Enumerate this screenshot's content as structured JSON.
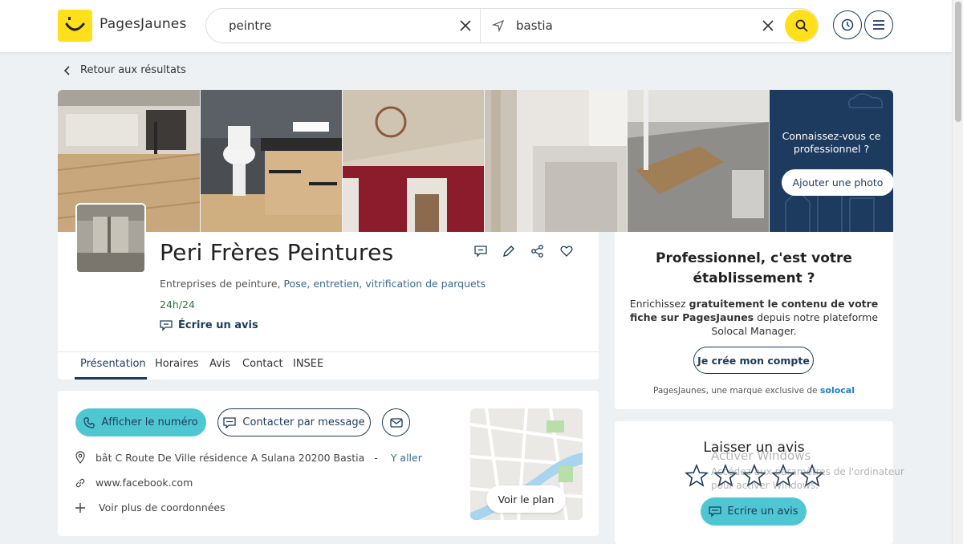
{
  "header": {
    "logo_text": "PagesJaunes",
    "search_what": "peintre",
    "search_where": "bastia"
  },
  "back_link": "Retour aux résultats",
  "gallery": {
    "promo_text": "Connaissez-vous ce professionnel ?",
    "promo_button": "Ajouter une photo"
  },
  "business": {
    "name": "Peri Frères Peintures",
    "category_main": "Entreprises de peinture,",
    "category_links": "Pose, entretien, vitrification de parquets",
    "hours": "24h/24",
    "write_review": "Écrire un avis"
  },
  "tabs": [
    {
      "label": "Présentation",
      "active": true
    },
    {
      "label": "Horaires",
      "active": false
    },
    {
      "label": "Avis",
      "active": false
    },
    {
      "label": "Contact",
      "active": false
    },
    {
      "label": "INSEE",
      "active": false
    }
  ],
  "contact": {
    "phone_button": "Afficher le numéro",
    "message_button": "Contacter par message",
    "address": "bât C Route De Ville résidence A Sulana 20200 Bastia",
    "address_sep": "-",
    "go_link": "Y aller",
    "website": "www.facebook.com",
    "more_details": "Voir plus de coordonnées",
    "map_button": "Voir le plan"
  },
  "pro_card": {
    "title": "Professionnel, c'est votre établissement ?",
    "desc_prefix": "Enrichissez",
    "desc_bold": "gratuitement le contenu de votre fiche sur PagesJaunes",
    "desc_suffix": "depuis notre plateforme Solocal Manager.",
    "button": "Je crée mon compte",
    "brand_text": "PagesJaunes, une marque exclusive de",
    "brand_name": "solocal"
  },
  "review_card": {
    "title": "Laisser un avis",
    "button": "Ecrire un avis",
    "star_count": 5
  },
  "watermark": {
    "line1": "Activer Windows",
    "line2": "Accédez aux paramètres de l'ordinateur pour activer Windows."
  },
  "colors": {
    "accent_yellow": "#ffe01b",
    "accent_cyan": "#4fc7d3",
    "navy": "#1c3b5a",
    "open_green": "#1f7a3a"
  }
}
